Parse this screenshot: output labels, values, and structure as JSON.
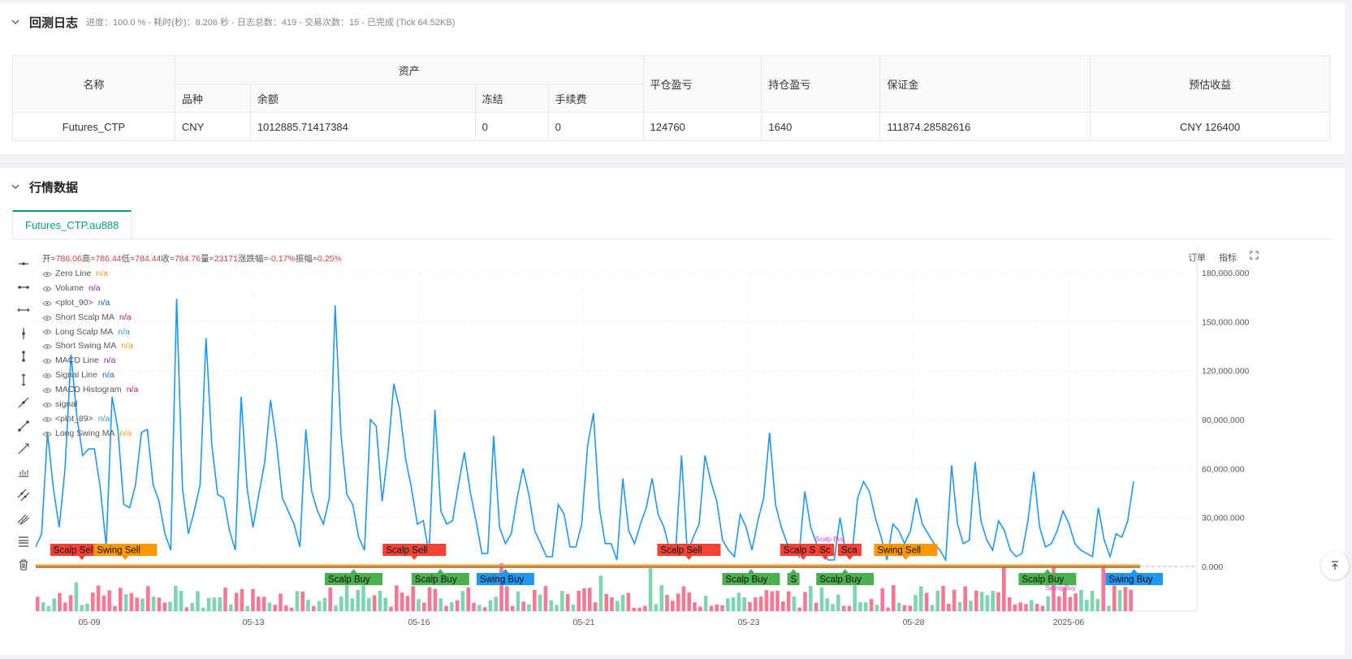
{
  "backtest": {
    "title": "回测日志",
    "status": "进度：100.0 % - 耗时(秒)：8.206 秒 - 日志总数：419 - 交易次数：15 - 已完成 (Tick 64.52KB)",
    "headers": {
      "name": "名称",
      "assets": "资产",
      "variety": "品种",
      "balance": "余额",
      "frozen": "冻结",
      "fee": "手续费",
      "close_pnl": "平仓盈亏",
      "hold_pnl": "持仓盈亏",
      "margin": "保证金",
      "est_profit": "预估收益"
    },
    "row": {
      "name": "Futures_CTP",
      "variety": "CNY",
      "balance": "1012885.71417384",
      "frozen": "0",
      "fee": "0",
      "close_pnl": "124760",
      "hold_pnl": "1640",
      "margin": "111874.28582616",
      "est_profit": "CNY 126400"
    }
  },
  "market": {
    "title": "行情数据",
    "tab": "Futures_CTP.au888",
    "buttons": {
      "order": "订单",
      "indicator": "指标"
    },
    "ohlc": {
      "open_l": "开=",
      "open": "786.06",
      "high_l": " 高=",
      "high": "786.44",
      "low_l": " 低=",
      "low": "784.44",
      "close_l": " 收=",
      "close": "784.76",
      "vol_l": " 量=",
      "vol": "23171",
      "chg_l": " 涨跌幅=",
      "chg": "-0.17%",
      "amp_l": " 振幅=",
      "amp": "0.25%"
    },
    "legend": [
      {
        "name": "Zero Line",
        "value": "n/a",
        "color": "#f59a23"
      },
      {
        "name": "Volume",
        "value": "n/a",
        "color": "#9c27b0"
      },
      {
        "name": "<plot_90>",
        "value": "n/a",
        "color": "#1565c0"
      },
      {
        "name": "Short Scalp MA",
        "value": "n/a",
        "color": "#c2185b"
      },
      {
        "name": "Long Scalp MA",
        "value": "n/a",
        "color": "#26a6c4"
      },
      {
        "name": "Short Swing MA",
        "value": "n/a",
        "color": "#f59a23"
      },
      {
        "name": "MACD Line",
        "value": "n/a",
        "color": "#9c27b0"
      },
      {
        "name": "Signal Line",
        "value": "n/a",
        "color": "#1565c0"
      },
      {
        "name": "MACD Histogram",
        "value": "n/a",
        "color": "#c2185b"
      },
      {
        "name": "signal",
        "value": "",
        "color": "#999999"
      },
      {
        "name": "<plot_89>",
        "value": "n/a",
        "color": "#26a6c4"
      },
      {
        "name": "Long Swing MA",
        "value": "n/a",
        "color": "#f59a23"
      }
    ]
  },
  "chart_data": {
    "type": "line",
    "y_ticks": [
      "180,000.000",
      "150,000.000",
      "120,000.000",
      "90,000.000",
      "60,000.000",
      "30,000.000",
      "0.000"
    ],
    "ylim": [
      0,
      180000
    ],
    "x_ticks": [
      "05-09",
      "05-13",
      "05-16",
      "05-21",
      "05-23",
      "05-28",
      "2025-06"
    ],
    "line_color": "#2196f3",
    "series": [
      {
        "values": [
          12000,
          20000,
          82000,
          48000,
          24000,
          60000,
          130000,
          92000,
          68000,
          72000,
          72000,
          48000,
          12000,
          104000,
          84000,
          38000,
          36000,
          50000,
          82000,
          84000,
          50000,
          40000,
          20000,
          10000,
          164000,
          48000,
          20000,
          34000,
          50000,
          140000,
          74000,
          44000,
          42000,
          22000,
          10000,
          104000,
          48000,
          24000,
          44000,
          64000,
          102000,
          76000,
          42000,
          34000,
          26000,
          12000,
          84000,
          46000,
          34000,
          26000,
          42000,
          160000,
          80000,
          44000,
          38000,
          18000,
          10000,
          90000,
          86000,
          40000,
          70000,
          112000,
          96000,
          66000,
          48000,
          26000,
          28000,
          8000,
          96000,
          34000,
          26000,
          28000,
          50000,
          70000,
          46000,
          28000,
          8000,
          8000,
          80000,
          24000,
          14000,
          20000,
          42000,
          60000,
          44000,
          22000,
          14000,
          6000,
          6000,
          38000,
          32000,
          12000,
          12000,
          26000,
          74000,
          94000,
          36000,
          14000,
          14000,
          4000,
          54000,
          22000,
          14000,
          26000,
          36000,
          54000,
          32000,
          24000,
          10000,
          10000,
          68000,
          8000,
          18000,
          26000,
          68000,
          52000,
          40000,
          16000,
          10000,
          6000,
          32000,
          24000,
          10000,
          28000,
          42000,
          82000,
          38000,
          24000,
          14000,
          12000,
          6000,
          46000,
          24000,
          14000,
          8000,
          4000,
          4000,
          30000,
          8000,
          6000,
          42000,
          52000,
          46000,
          30000,
          18000,
          4000,
          26000,
          22000,
          14000,
          22000,
          42000,
          26000,
          20000,
          14000,
          10000,
          4000,
          62000,
          26000,
          14000,
          16000,
          64000,
          28000,
          16000,
          10000,
          28000,
          22000,
          10000,
          6000,
          8000,
          28000,
          58000,
          24000,
          12000,
          14000,
          22000,
          34000,
          26000,
          14000,
          10000,
          8000,
          6000,
          36000,
          16000,
          6000,
          20000,
          18000,
          28000,
          52000
        ]
      }
    ],
    "signals": [
      {
        "label": "Scalp Sell",
        "color": "#f44336",
        "x": 2,
        "side": "top"
      },
      {
        "label": "Swing Sell",
        "color": "#ff9800",
        "x": 8,
        "side": "top"
      },
      {
        "label": "Scalp Sell",
        "color": "#f44336",
        "x": 48,
        "side": "top"
      },
      {
        "label": "Scalp Sell",
        "color": "#f44336",
        "x": 86,
        "side": "top"
      },
      {
        "label": "Scalp S",
        "color": "#f44336",
        "x": 103,
        "side": "top"
      },
      {
        "label": "Sc",
        "color": "#f44336",
        "x": 108,
        "side": "top"
      },
      {
        "label": "Sca",
        "color": "#f44336",
        "x": 111,
        "side": "top"
      },
      {
        "label": "Swing Sell",
        "color": "#ff9800",
        "x": 116,
        "side": "top"
      },
      {
        "label": "Scalp Buy",
        "color": "#4caf50",
        "x": 40,
        "side": "bottom"
      },
      {
        "label": "Scalp Buy",
        "color": "#4caf50",
        "x": 52,
        "side": "bottom"
      },
      {
        "label": "Swing Buy",
        "color": "#2196f3",
        "x": 61,
        "side": "bottom"
      },
      {
        "label": "Scalp Buy",
        "color": "#4caf50",
        "x": 95,
        "side": "bottom"
      },
      {
        "label": "S",
        "color": "#4caf50",
        "x": 104,
        "side": "bottom"
      },
      {
        "label": "Scalp Buy",
        "color": "#4caf50",
        "x": 108,
        "side": "bottom"
      },
      {
        "label": "Scalp Buy",
        "color": "#4caf50",
        "x": 136,
        "side": "bottom"
      },
      {
        "label": "Swing Buy",
        "color": "#2196f3",
        "x": 148,
        "side": "bottom"
      }
    ],
    "small_labels": [
      {
        "label": "Scalp Buy",
        "color": "#e040fb"
      },
      {
        "label": "Swing Buy",
        "color": "#e040fb"
      }
    ],
    "volume_colors": {
      "up": "#6fd1a8",
      "down": "#f46a8a"
    },
    "grid": true
  }
}
